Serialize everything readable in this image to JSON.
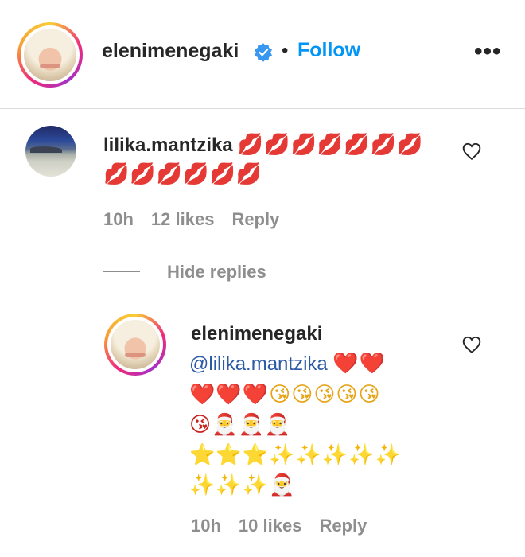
{
  "header": {
    "username": "elenimenegaki",
    "separator": "•",
    "follow_label": "Follow",
    "more_label": "•••"
  },
  "comment": {
    "username": "lilika.mantzika",
    "emojis": "💋💋💋💋💋💋💋💋💋💋💋💋💋",
    "time": "10h",
    "likes": "12 likes",
    "reply_label": "Reply"
  },
  "hide_replies_label": "Hide replies",
  "reply": {
    "username": "elenimenegaki",
    "mention": "@lilika.mantzika",
    "line1_emojis": "❤️❤️",
    "line2_emojis": "❤️❤️❤️😘😘😘😘😘",
    "line3_emojis": "😘🎅🎅🎅",
    "line4_emojis": "⭐⭐⭐✨✨✨✨✨",
    "line5_emojis": "✨✨✨🎅",
    "time": "10h",
    "likes": "10 likes",
    "reply_label": "Reply"
  },
  "colors": {
    "link_blue": "#0095f6",
    "mention_blue": "#2b5aa6",
    "muted_gray": "#8e8e8e",
    "divider": "#dbdbdb"
  },
  "icons": {
    "verified": "verified-badge-icon",
    "like": "heart-outline-icon",
    "more": "more-options-icon"
  }
}
